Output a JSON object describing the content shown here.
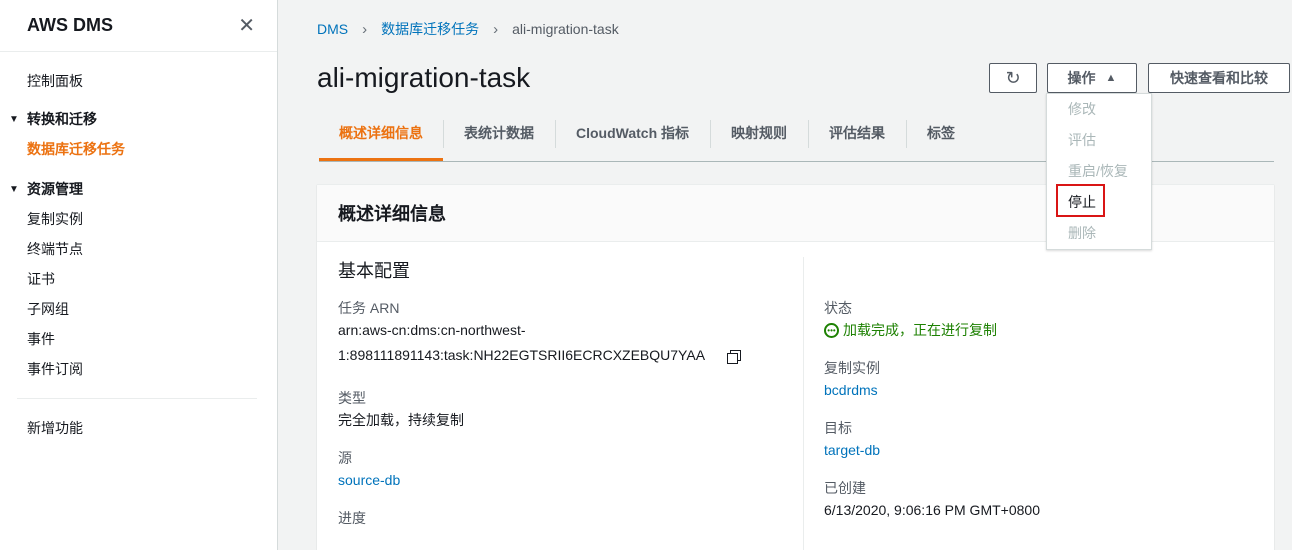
{
  "sidebar": {
    "title": "AWS DMS",
    "close_icon": "close-icon",
    "dashboard": "控制面板",
    "section_migrate": "转换和迁移",
    "db_migration_tasks": "数据库迁移任务",
    "section_resources": "资源管理",
    "resources": [
      "复制实例",
      "终端节点",
      "证书",
      "子网组",
      "事件",
      "事件订阅"
    ],
    "whats_new": "新增功能"
  },
  "breadcrumb": {
    "root": "DMS",
    "parent": "数据库迁移任务",
    "current": "ali-migration-task"
  },
  "page": {
    "title": "ali-migration-task"
  },
  "toolbar": {
    "refresh_icon": "refresh-icon",
    "actions_label": "操作",
    "compare_label": "快速查看和比较"
  },
  "actions_menu": {
    "items": [
      {
        "label": "修改",
        "enabled": false
      },
      {
        "label": "评估",
        "enabled": false
      },
      {
        "label": "重启/恢复",
        "enabled": false
      },
      {
        "label": "停止",
        "enabled": true
      },
      {
        "label": "删除",
        "enabled": false
      }
    ]
  },
  "tabs": [
    "概述详细信息",
    "表统计数据",
    "CloudWatch 指标",
    "映射规则",
    "评估结果",
    "标签"
  ],
  "panel": {
    "title": "概述详细信息",
    "section": "基本配置",
    "arn_label": "任务 ARN",
    "arn_line1": "arn:aws-cn:dms:cn-northwest-",
    "arn_line2": "1:898111891143:task:NH22EGTSRII6ECRCXZEBQU7YAA",
    "type_label": "类型",
    "type_value": "完全加载，持续复制",
    "source_label": "源",
    "source_value": "source-db",
    "progress_label": "进度",
    "status_label": "状态",
    "status_value": "加载完成，正在进行复制",
    "instance_label": "复制实例",
    "instance_value": "bcdrdms",
    "target_label": "目标",
    "target_value": "target-db",
    "created_label": "已创建",
    "created_value": "6/13/2020, 9:06:16 PM GMT+0800"
  },
  "colors": {
    "accent": "#ec7211",
    "link": "#0073bb",
    "success": "#1d8102",
    "highlight": "#d91515"
  }
}
